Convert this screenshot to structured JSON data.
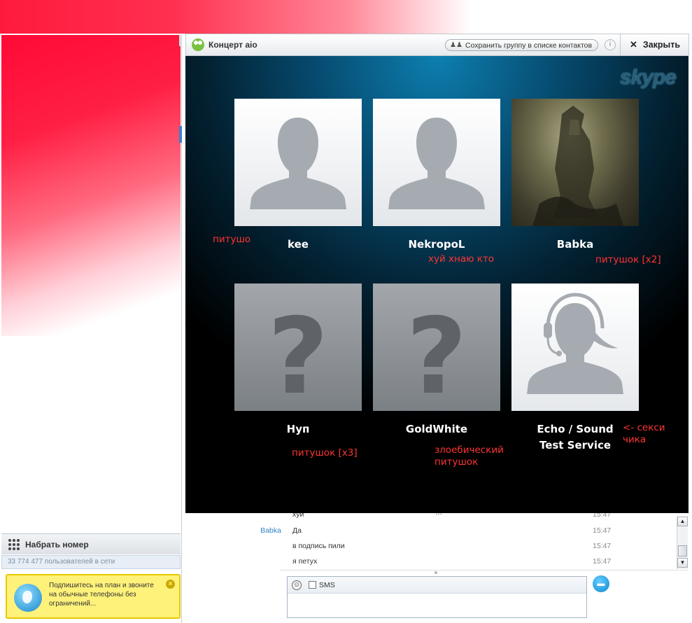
{
  "window": {
    "chat_title": "Концерт aio",
    "save_group_label": "Сохранить группу в списке контактов",
    "info_label": "i",
    "close_label": "Закрыть",
    "brand": "skype"
  },
  "participants": [
    {
      "name": "kee",
      "avatar": "default-person"
    },
    {
      "name": "NekropoL",
      "avatar": "default-person"
    },
    {
      "name": "Babka",
      "avatar": "photo"
    },
    {
      "name": "Нуп",
      "avatar": "unknown"
    },
    {
      "name": "GoldWhite",
      "avatar": "unknown"
    },
    {
      "name": "Echo / Sound Test Service",
      "avatar": "headset-agent"
    }
  ],
  "annotations": [
    {
      "text": "питушо"
    },
    {
      "text": "хуй хнаю кто"
    },
    {
      "text": "питушок [x2]"
    },
    {
      "text": "<- секси чика"
    },
    {
      "text": "питушок [x3]"
    },
    {
      "text": "злоебический питушок"
    }
  ],
  "chat": {
    "messages": [
      {
        "sender": "",
        "text": "хуй",
        "time": "15:47"
      },
      {
        "sender": "Babka",
        "text": "Да",
        "time": "15:47"
      },
      {
        "sender": "",
        "text": "в подпись пили",
        "time": "15:47"
      },
      {
        "sender": "",
        "text": "я петух",
        "time": "15:47"
      }
    ],
    "sms_label": "SMS"
  },
  "sidebar": {
    "dial_label": "Набрать номер",
    "users_online": "33 774 477 пользователей в сети",
    "promo_text": "Подпишитесь на план и звоните на обычные телефоны без ограничений..."
  }
}
